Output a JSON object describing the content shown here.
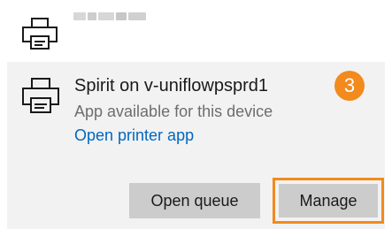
{
  "top_printer": {
    "name_blurred": true
  },
  "printer": {
    "name": "Spirit on v-uniflowpsprd1",
    "status": "App available for this device",
    "open_app_link": "Open printer app"
  },
  "step_badge": "3",
  "buttons": {
    "open_queue": "Open queue",
    "manage": "Manage"
  },
  "colors": {
    "accent_link": "#0067c0",
    "highlight": "#f28a1e",
    "card_bg": "#f2f2f2",
    "button_bg": "#cccccc"
  },
  "icons": {
    "top_printer": "printer-icon",
    "main_printer": "printer-icon"
  }
}
